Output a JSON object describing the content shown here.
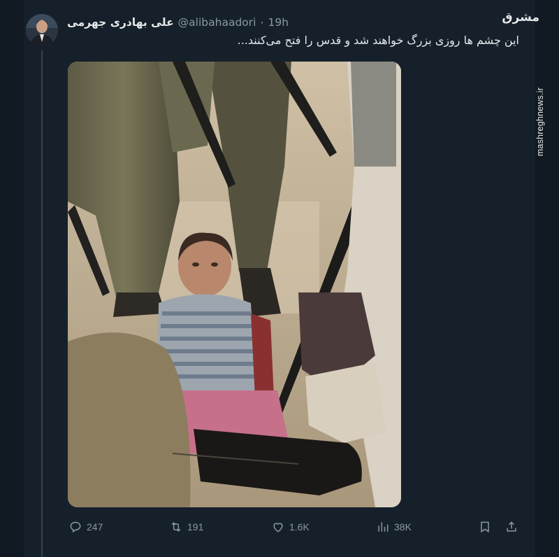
{
  "tweet": {
    "display_name": "علی بهادری جهرمی",
    "handle": "@alibahaadori",
    "separator": "·",
    "time": "19h",
    "text": "این چشم ها روزی بزرگ خواهند شد و قدس را فتح می‌کنند..."
  },
  "watermark": {
    "logo_text": "مشرق",
    "site": "mashreghnews.ir"
  },
  "actions": {
    "replies": "247",
    "retweets": "191",
    "likes": "1.6K",
    "views": "38K"
  },
  "icons": {
    "reply": "reply-icon",
    "retweet": "retweet-icon",
    "like": "heart-icon",
    "views": "analytics-icon",
    "bookmark": "bookmark-icon",
    "share": "share-icon"
  },
  "colors": {
    "background": "#15202b",
    "muted_text": "#8b98a5",
    "primary_text": "#e7e9ea"
  }
}
